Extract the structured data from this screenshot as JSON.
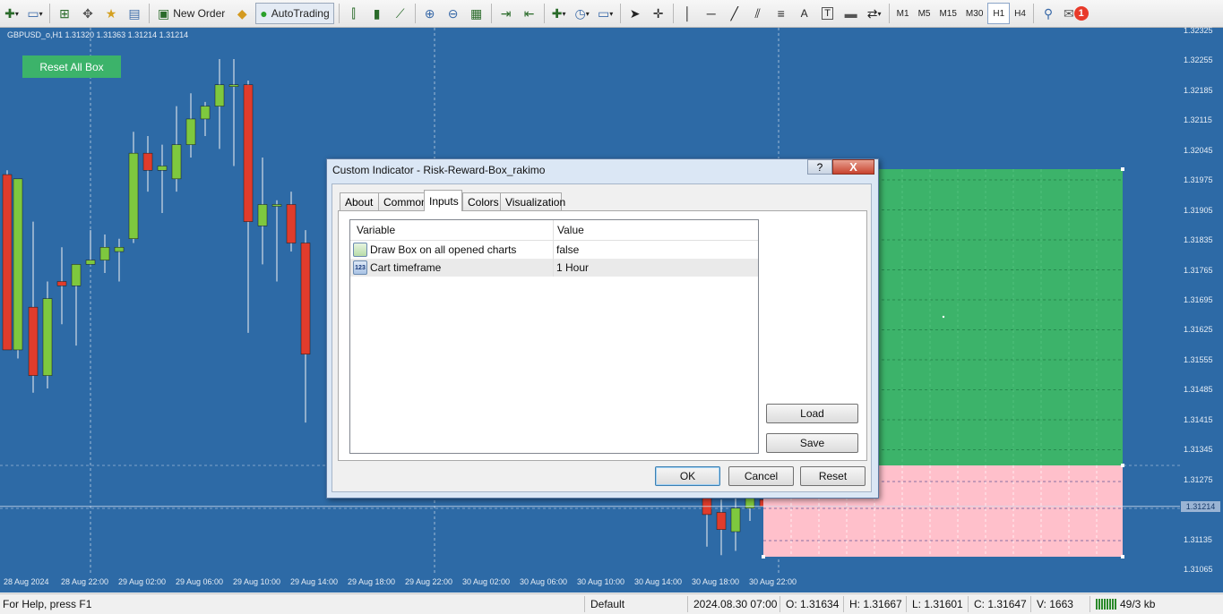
{
  "toolbar": {
    "new_order_label": "New Order",
    "autotrading_label": "AutoTrading",
    "timeframes": [
      "M1",
      "M5",
      "M15",
      "M30",
      "H1",
      "H4"
    ],
    "active_timeframe": "H1",
    "notification_count": "1"
  },
  "chart": {
    "symbol_info": "GBPUSD_o,H1  1.31320 1.31363 1.31214 1.31214",
    "reset_button_label": "Reset All Box",
    "background_color": "#2d6aa6",
    "bull_color": "#7ec83e",
    "bear_color": "#e03c2c",
    "reward_box_color": "#3cb36a",
    "risk_box_color": "#ffc0cb",
    "price_ticks": [
      "1.32325",
      "1.32255",
      "1.32185",
      "1.32115",
      "1.32045",
      "1.31975",
      "1.31905",
      "1.31835",
      "1.31765",
      "1.31695",
      "1.31625",
      "1.31555",
      "1.31485",
      "1.31415",
      "1.31345",
      "1.31275",
      "1.31214",
      "1.31135",
      "1.31065"
    ],
    "current_price": "1.31214",
    "time_ticks": [
      "28 Aug 2024",
      "28 Aug 22:00",
      "29 Aug 02:00",
      "29 Aug 06:00",
      "29 Aug 10:00",
      "29 Aug 14:00",
      "29 Aug 18:00",
      "29 Aug 22:00",
      "30 Aug 02:00",
      "30 Aug 06:00",
      "30 Aug 10:00",
      "30 Aug 14:00",
      "30 Aug 18:00",
      "30 Aug 22:00"
    ]
  },
  "dialog": {
    "title": "Custom Indicator - Risk-Reward-Box_rakimo",
    "help_label": "?",
    "close_label": "X",
    "tabs": [
      "About",
      "Common",
      "Inputs",
      "Colors",
      "Visualization"
    ],
    "active_tab": "Inputs",
    "columns": [
      "Variable",
      "Value"
    ],
    "rows": [
      {
        "variable": "Draw Box on all opened charts",
        "value": "false",
        "icon": "bool-icon",
        "icon_text": ""
      },
      {
        "variable": "Cart timeframe",
        "value": "1 Hour",
        "icon": "number-icon",
        "icon_text": "123"
      }
    ],
    "load_label": "Load",
    "save_label": "Save",
    "ok_label": "OK",
    "cancel_label": "Cancel",
    "reset_label": "Reset"
  },
  "status": {
    "help_text": "For Help, press F1",
    "profile": "Default",
    "datetime": "2024.08.30 07:00",
    "open": "O: 1.31634",
    "high": "H: 1.31667",
    "low": "L: 1.31601",
    "close": "C: 1.31647",
    "volume": "V: 1663",
    "traffic": "49/3 kb"
  }
}
